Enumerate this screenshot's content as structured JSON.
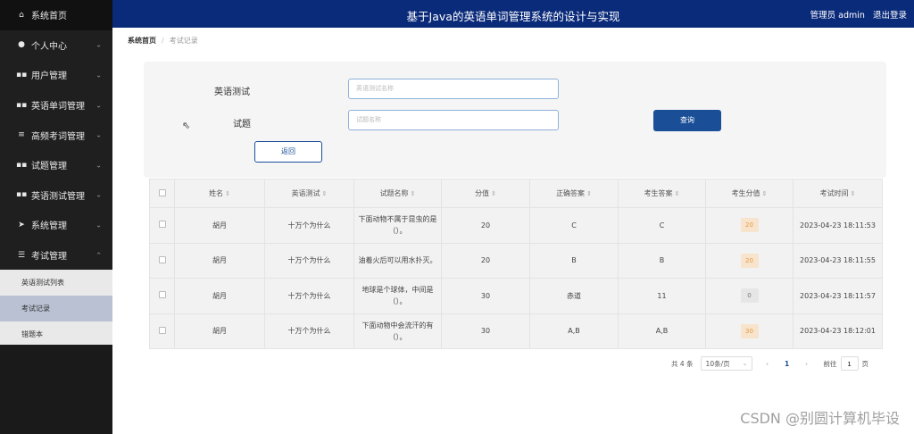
{
  "header": {
    "title": "基于Java的英语单词管理系统的设计与实现",
    "user_label": "管理员 admin",
    "logout": "退出登录"
  },
  "sidebar": {
    "items": [
      {
        "label": "系统首页",
        "icon": "home-icon",
        "glyph": "⌂"
      },
      {
        "label": "个人中心",
        "icon": "user-icon",
        "glyph": "●"
      },
      {
        "label": "用户管理",
        "icon": "grid-icon",
        "glyph": "▪▪"
      },
      {
        "label": "英语单词管理",
        "icon": "grid-icon",
        "glyph": "▪▪"
      },
      {
        "label": "高频考词管理",
        "icon": "list-icon",
        "glyph": "≡"
      },
      {
        "label": "试题管理",
        "icon": "grid-icon",
        "glyph": "▪▪"
      },
      {
        "label": "英语测试管理",
        "icon": "grid-icon",
        "glyph": "▪▪"
      },
      {
        "label": "系统管理",
        "icon": "send-icon",
        "glyph": "➤"
      },
      {
        "label": "考试管理",
        "icon": "exam-icon",
        "glyph": "☰"
      }
    ],
    "sub_items": [
      "英语测试列表",
      "考试记录",
      "错题本"
    ]
  },
  "breadcrumb": {
    "home": "系统首页",
    "current": "考试记录"
  },
  "search": {
    "test_label": "英语测试",
    "test_placeholder": "英语测试名称",
    "question_label": "试题",
    "question_placeholder": "试题名称",
    "query_button": "查询",
    "back_button": "返回"
  },
  "table": {
    "columns": [
      "姓名",
      "英语测试",
      "试题名称",
      "分值",
      "正确答案",
      "考生答案",
      "考生分值",
      "考试时间"
    ],
    "rows": [
      {
        "name": "胡月",
        "test": "十万个为什么",
        "question": "下面动物不属于昆虫的是（）。",
        "score": "20",
        "correct": "C",
        "answer": "C",
        "got": "20",
        "time": "2023-04-23 18:11:53"
      },
      {
        "name": "胡月",
        "test": "十万个为什么",
        "question": "油着火后可以用水扑灭。",
        "score": "20",
        "correct": "B",
        "answer": "B",
        "got": "20",
        "time": "2023-04-23 18:11:55"
      },
      {
        "name": "胡月",
        "test": "十万个为什么",
        "question": "地球是个球体，中间是（）。",
        "score": "30",
        "correct": "赤道",
        "answer": "11",
        "got": "0",
        "time": "2023-04-23 18:11:57"
      },
      {
        "name": "胡月",
        "test": "十万个为什么",
        "question": "下面动物中会流汗的有（）。",
        "score": "30",
        "correct": "A,B",
        "answer": "A,B",
        "got": "30",
        "time": "2023-04-23 18:12:01"
      }
    ]
  },
  "pagination": {
    "total": "共 4 条",
    "page_size": "10条/页",
    "current_page": "1",
    "goto_label": "前往",
    "goto_value": "1",
    "page_suffix": "页"
  },
  "watermark": "CSDN @别圆计算机毕设",
  "colors": {
    "header_bg": "#0a2a7a",
    "sidebar_bg": "#1f1f1f",
    "accent": "#1a4f97",
    "badge_bg": "#f8e4cc"
  }
}
